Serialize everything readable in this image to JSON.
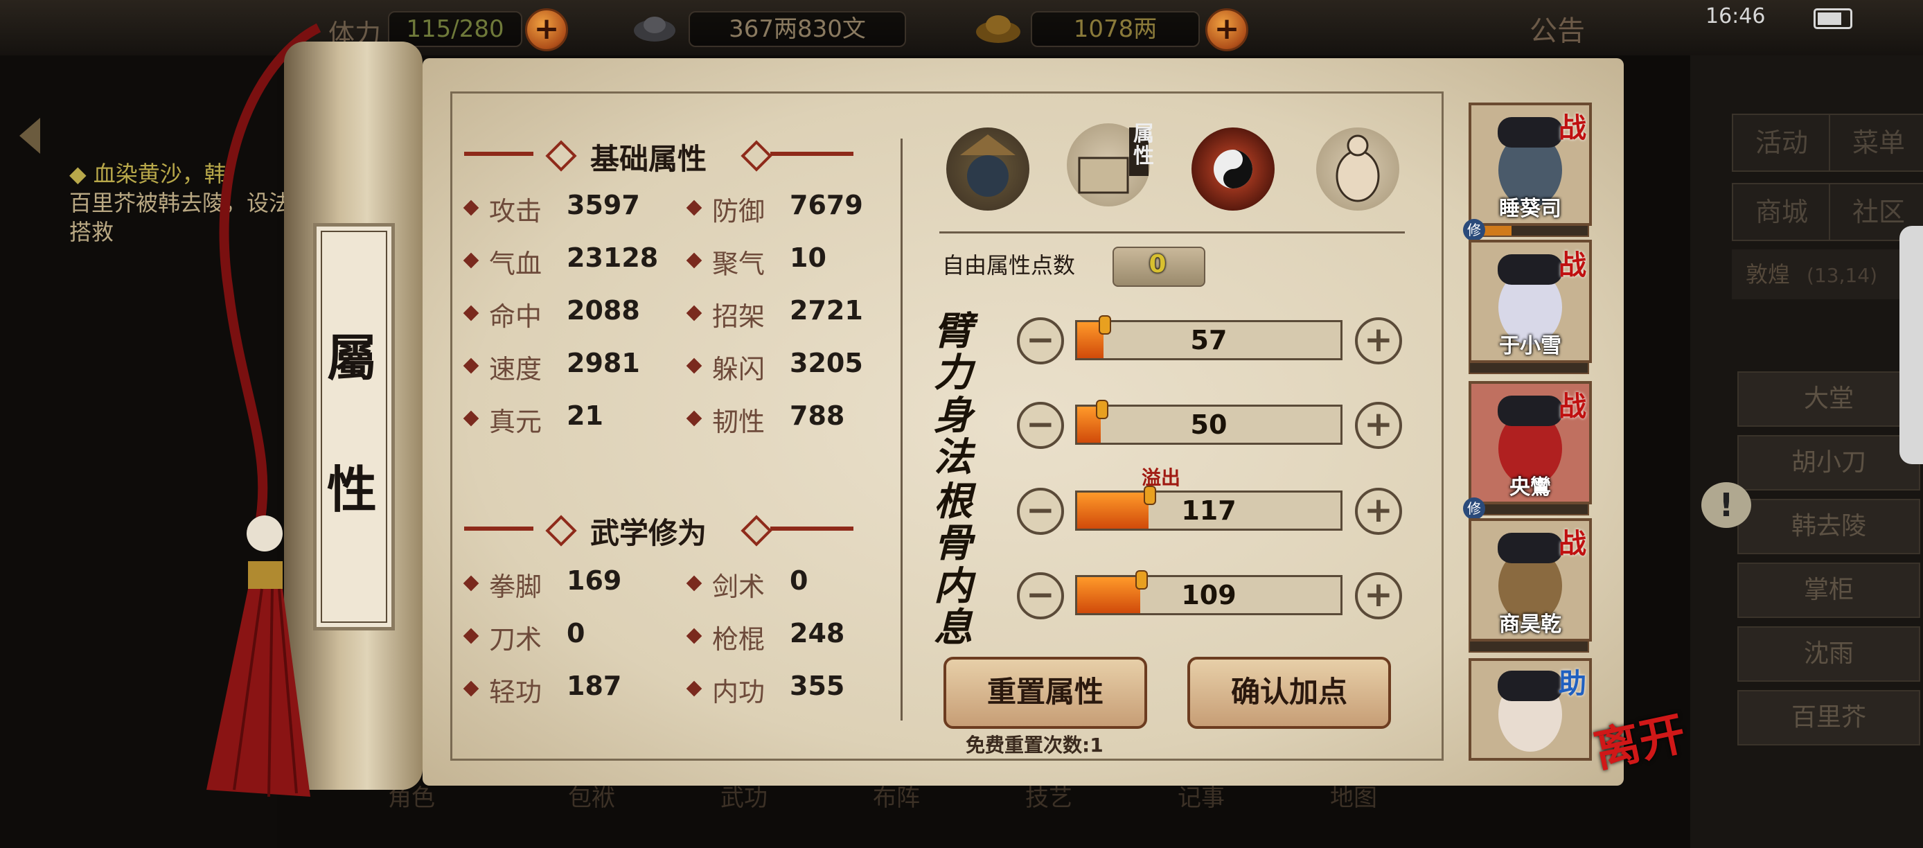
{
  "topbar": {
    "stamina_label": "体力",
    "stamina": "115/280",
    "silver": "367两830文",
    "gold": "1078两",
    "announce": "公告",
    "clock": "16:46"
  },
  "quest": {
    "title": "血染黄沙，韩",
    "desc": "百里芥被韩去陵，设法搭救"
  },
  "right_menu": {
    "buttons": [
      "活动",
      "菜单",
      "商城",
      "社区"
    ],
    "location": "敦煌",
    "coords": "(13,14)",
    "npcs": [
      "大堂",
      "胡小刀",
      "韩去陵",
      "掌柜",
      "沈雨",
      "百里芥"
    ]
  },
  "bottom_nav": [
    "角色",
    "包袱",
    "武功",
    "布阵",
    "技艺",
    "记事",
    "地图"
  ],
  "scroll": {
    "chars": [
      "屬",
      "性"
    ]
  },
  "basic": {
    "title": "基础属性",
    "stats": [
      {
        "label": "攻击",
        "value": "3597"
      },
      {
        "label": "防御",
        "value": "7679"
      },
      {
        "label": "气血",
        "value": "23128"
      },
      {
        "label": "聚气",
        "value": "10"
      },
      {
        "label": "命中",
        "value": "2088"
      },
      {
        "label": "招架",
        "value": "2721"
      },
      {
        "label": "速度",
        "value": "2981"
      },
      {
        "label": "躲闪",
        "value": "3205"
      },
      {
        "label": "真元",
        "value": "21"
      },
      {
        "label": "韧性",
        "value": "788"
      }
    ]
  },
  "martial": {
    "title": "武学修为",
    "stats": [
      {
        "label": "拳脚",
        "value": "169"
      },
      {
        "label": "剑术",
        "value": "0"
      },
      {
        "label": "刀术",
        "value": "0"
      },
      {
        "label": "枪棍",
        "value": "248"
      },
      {
        "label": "轻功",
        "value": "187"
      },
      {
        "label": "内功",
        "value": "355"
      }
    ]
  },
  "tabs": {
    "active_label": "属性"
  },
  "allocation": {
    "free_points_label": "自由属性点数",
    "free_points": "0",
    "overflow_label": "溢出",
    "attrs": [
      {
        "name": "臂力",
        "value": "57",
        "fill": 0.1
      },
      {
        "name": "身法",
        "value": "50",
        "fill": 0.09
      },
      {
        "name": "根骨",
        "value": "117",
        "fill": 0.27
      },
      {
        "name": "内息",
        "value": "109",
        "fill": 0.24
      }
    ],
    "reset_label": "重置属性",
    "confirm_label": "确认加点",
    "free_reset": "免费重置次数:1"
  },
  "party": [
    {
      "name": "睡葵司",
      "badge": "战",
      "cultivate": "修"
    },
    {
      "name": "于小雪",
      "badge": "战"
    },
    {
      "name": "央鸞",
      "badge": "战",
      "cultivate": "修"
    },
    {
      "name": "商昊乾",
      "badge": "战"
    },
    {
      "name": "",
      "badge": "助"
    }
  ],
  "leave_label": "离开",
  "colors": {
    "accent_red": "#8e2a1a",
    "bar_orange": "#ff9a2a",
    "badge_red": "#c01010",
    "badge_blue": "#2060c0"
  }
}
